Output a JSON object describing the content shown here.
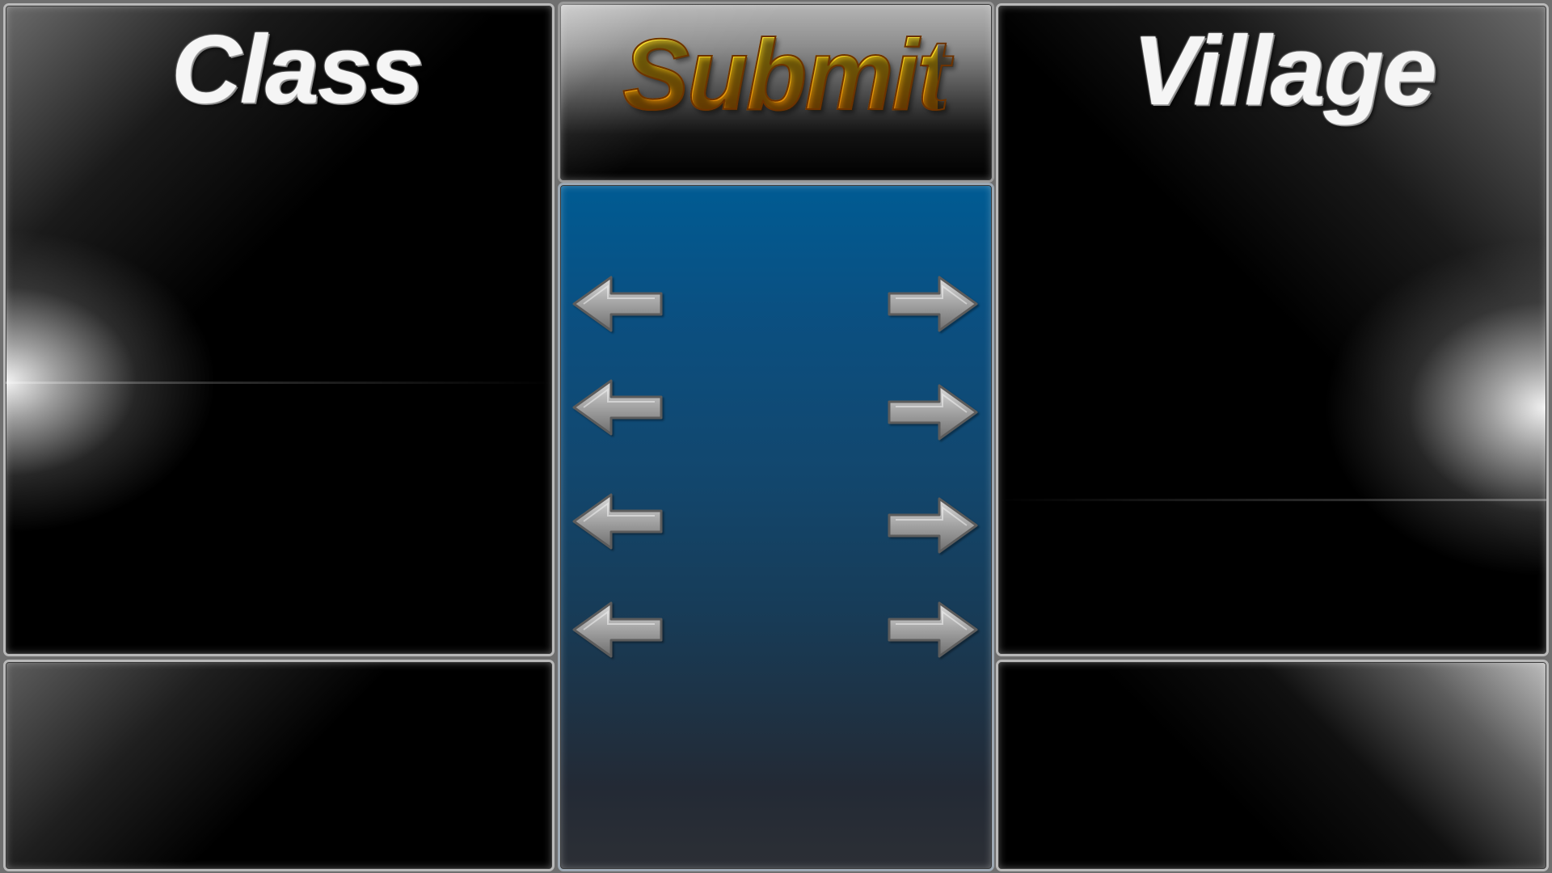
{
  "screen": {
    "background": "#6f6f6f",
    "panel_border": "#b9b9b9"
  },
  "left_panel": {
    "title": "Class"
  },
  "right_panel": {
    "title": "Village"
  },
  "submit": {
    "label": "Submit"
  },
  "arrows": {
    "left_icon": "arrow-left-icon",
    "right_icon": "arrow-right-icon",
    "rows": 4
  },
  "colors": {
    "center_gradient_top": "#005b93",
    "center_gradient_bottom": "#2c2f35",
    "submit_gold": "#f6cf18",
    "submit_orange": "#c95a02",
    "arrow_face": "#b8b8b8",
    "arrow_edge": "#5c5c5c"
  }
}
